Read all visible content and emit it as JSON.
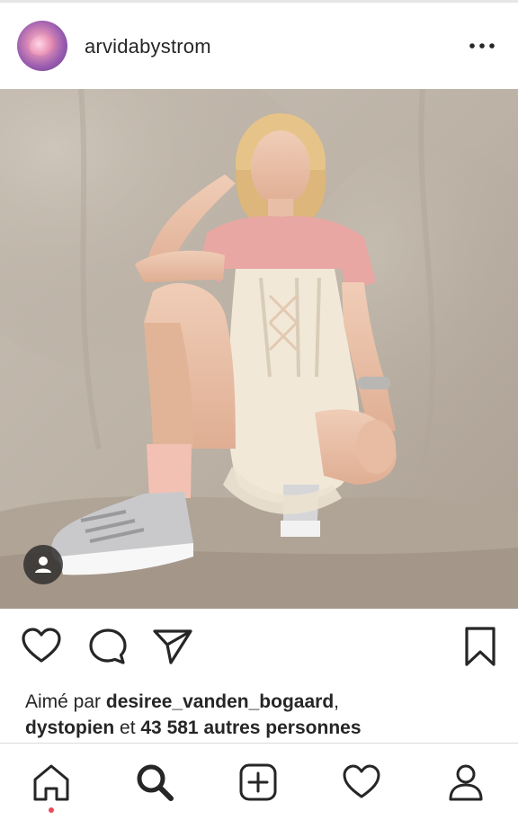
{
  "post": {
    "username": "arvidabystrom",
    "avatar_icon": "profile-avatar",
    "more_icon": "more-horizontal-icon",
    "photo_tag_icon": "user-tag-icon"
  },
  "actions": {
    "like_icon": "heart-icon",
    "comment_icon": "comment-bubble-icon",
    "share_icon": "paper-plane-icon",
    "save_icon": "bookmark-icon"
  },
  "likes": {
    "prefix": "Aimé par ",
    "user1": "desiree_vanden_bogaard",
    "comma": ",",
    "user2": "dystopien",
    "conjunction": " et ",
    "others": "43 581 autres personnes"
  },
  "tabbar": {
    "items": [
      "home-icon",
      "search-icon",
      "add-post-icon",
      "activity-heart-icon",
      "profile-icon"
    ],
    "notification_color": "#ed4956"
  },
  "colors": {
    "text": "#262626",
    "divider": "#dbdbdb",
    "backdrop": "#bdb3a7"
  }
}
